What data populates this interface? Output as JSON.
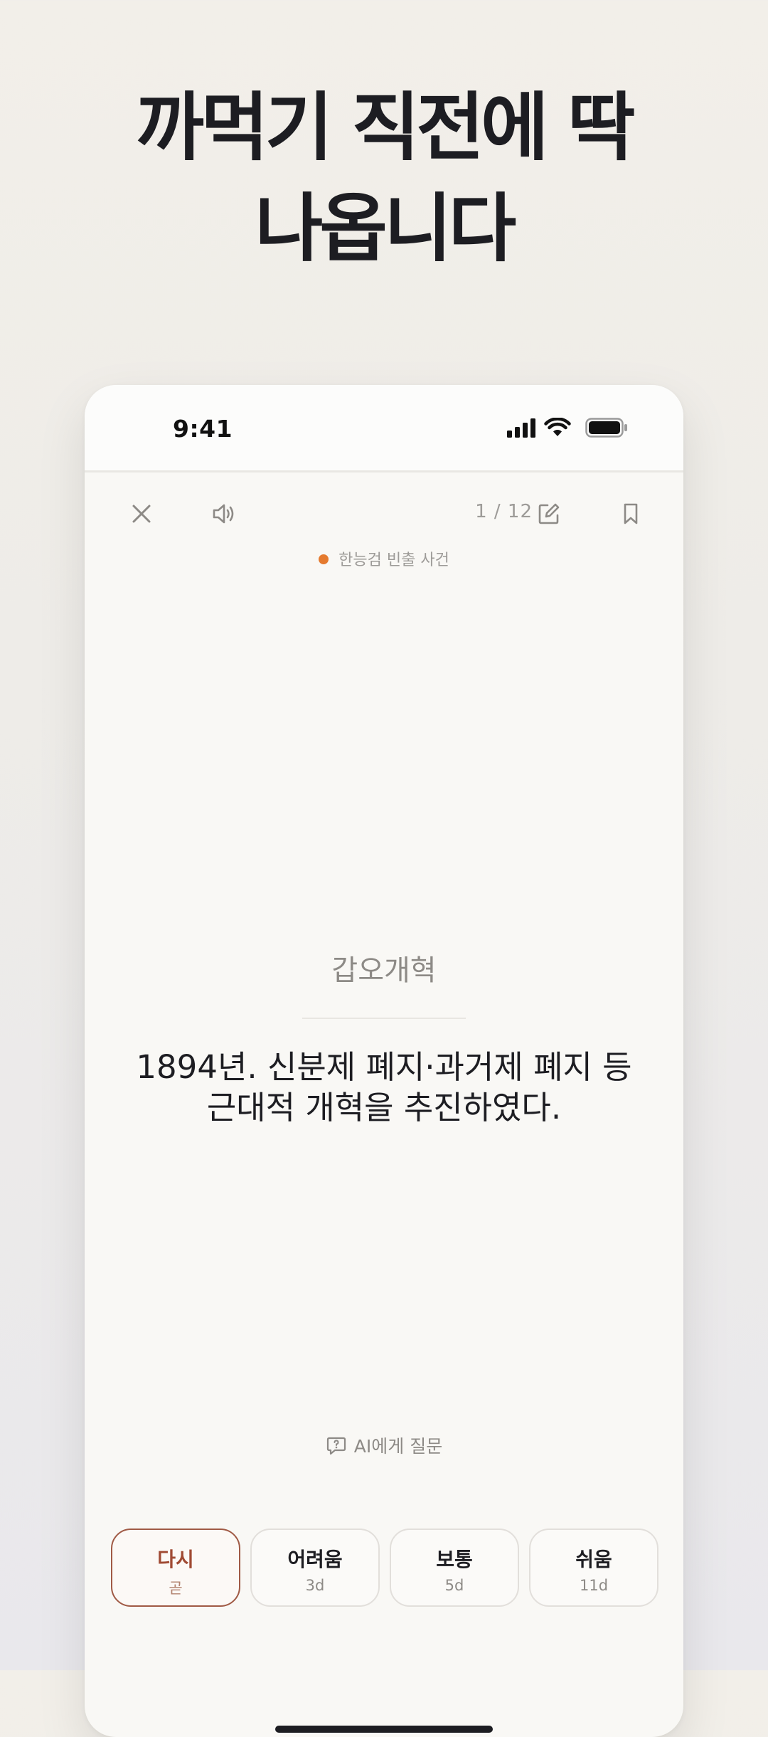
{
  "headline": {
    "line1": "까먹기 직전에 딱",
    "line2": "나옵니다"
  },
  "status_bar": {
    "time": "9:41",
    "icons": [
      "cellular-signal-icon",
      "wifi-icon",
      "battery-icon"
    ]
  },
  "toolbar": {
    "icons": [
      "close-icon",
      "speaker-icon",
      "edit-icon",
      "bookmark-icon"
    ],
    "counter": "1 / 12"
  },
  "deck": {
    "name": "한능검 빈출 사건",
    "dot_color": "#e57a2e"
  },
  "card": {
    "front": "갑오개혁",
    "back_line1": "1894년. 신분제 폐지·과거제 폐지 등",
    "back_line2": "근대적 개혁을 추진하였다."
  },
  "ask_ai": {
    "label": "AI에게 질문",
    "icon": "chat-question-icon"
  },
  "grades": [
    {
      "label": "다시",
      "interval": "곧"
    },
    {
      "label": "어려움",
      "interval": "3d"
    },
    {
      "label": "보통",
      "interval": "5d"
    },
    {
      "label": "쉬움",
      "interval": "11d"
    }
  ],
  "colors": {
    "accent": "#a04a33",
    "text": "#1d1d22",
    "muted": "#8d8a86",
    "card_bg": "#f9f8f5"
  }
}
